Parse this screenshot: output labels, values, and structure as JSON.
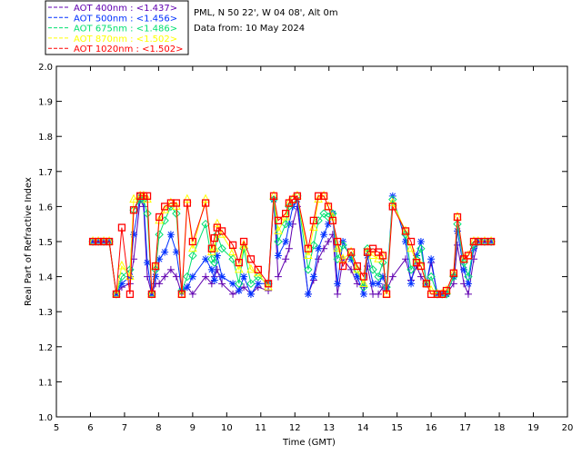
{
  "header": {
    "site": "PML, N 50 22', W 04 08', Alt 0m",
    "date": "Data from: 10 May 2024"
  },
  "chart_data": {
    "type": "line",
    "title": "",
    "xlabel": "Time (GMT)",
    "ylabel": "Real Part of Refractive Index",
    "xlim": [
      5,
      20
    ],
    "ylim": [
      1.0,
      2.0
    ],
    "xticks": [
      "5",
      "6",
      "7",
      "8",
      "9",
      "10",
      "11",
      "12",
      "13",
      "14",
      "15",
      "16",
      "17",
      "18",
      "19",
      "20"
    ],
    "yticks": [
      "1.0",
      "1.1",
      "1.2",
      "1.3",
      "1.4",
      "1.5",
      "1.6",
      "1.7",
      "1.8",
      "1.9",
      "2.0"
    ],
    "grid": false,
    "legend_position": "top-left",
    "x": [
      6.07,
      6.23,
      6.39,
      6.55,
      6.76,
      6.92,
      7.16,
      7.27,
      7.46,
      7.56,
      7.67,
      7.8,
      7.91,
      8.02,
      8.18,
      8.36,
      8.52,
      8.68,
      8.84,
      9.0,
      9.38,
      9.56,
      9.64,
      9.72,
      9.86,
      10.18,
      10.36,
      10.5,
      10.71,
      10.92,
      11.22,
      11.38,
      11.51,
      11.73,
      11.83,
      11.94,
      12.07,
      12.39,
      12.55,
      12.69,
      12.85,
      12.98,
      13.11,
      13.25,
      13.41,
      13.65,
      13.83,
      14.02,
      14.13,
      14.29,
      14.45,
      14.58,
      14.69,
      14.87,
      15.25,
      15.41,
      15.57,
      15.7,
      15.86,
      16.0,
      16.18,
      16.32,
      16.45,
      16.66,
      16.77,
      16.96,
      17.09,
      17.25,
      17.38,
      17.57,
      17.76
    ],
    "series": [
      {
        "name": "AOT  400nm : <1.437>",
        "color": "#6000b0",
        "marker": "plus",
        "values": [
          1.5,
          1.5,
          1.5,
          1.5,
          1.35,
          1.37,
          1.38,
          1.45,
          1.62,
          1.6,
          1.4,
          1.35,
          1.38,
          1.38,
          1.4,
          1.42,
          1.4,
          1.35,
          1.37,
          1.35,
          1.4,
          1.38,
          1.4,
          1.42,
          1.38,
          1.35,
          1.36,
          1.37,
          1.35,
          1.37,
          1.36,
          1.62,
          1.4,
          1.45,
          1.48,
          1.55,
          1.6,
          1.35,
          1.39,
          1.45,
          1.48,
          1.5,
          1.52,
          1.35,
          1.45,
          1.42,
          1.38,
          1.37,
          1.43,
          1.35,
          1.35,
          1.37,
          1.36,
          1.4,
          1.45,
          1.39,
          1.43,
          1.4,
          1.38,
          1.44,
          1.35,
          1.35,
          1.35,
          1.38,
          1.49,
          1.38,
          1.35,
          1.45,
          1.5,
          1.5,
          1.5
        ]
      },
      {
        "name": "AOT  500nm : <1.456>",
        "color": "#0030ff",
        "marker": "asterisk",
        "values": [
          1.5,
          1.5,
          1.5,
          1.5,
          1.35,
          1.38,
          1.4,
          1.52,
          1.63,
          1.62,
          1.44,
          1.35,
          1.4,
          1.45,
          1.47,
          1.52,
          1.47,
          1.36,
          1.37,
          1.4,
          1.45,
          1.42,
          1.39,
          1.46,
          1.4,
          1.38,
          1.36,
          1.4,
          1.35,
          1.38,
          1.38,
          1.62,
          1.46,
          1.5,
          1.55,
          1.6,
          1.62,
          1.35,
          1.4,
          1.48,
          1.52,
          1.55,
          1.58,
          1.38,
          1.5,
          1.45,
          1.4,
          1.35,
          1.46,
          1.38,
          1.38,
          1.4,
          1.37,
          1.63,
          1.5,
          1.38,
          1.46,
          1.5,
          1.38,
          1.45,
          1.35,
          1.35,
          1.35,
          1.4,
          1.53,
          1.42,
          1.38,
          1.48,
          1.5,
          1.5,
          1.5
        ]
      },
      {
        "name": "AOT  675nm : <1.486>",
        "color": "#00e070",
        "marker": "diamond",
        "values": [
          1.5,
          1.5,
          1.5,
          1.5,
          1.35,
          1.4,
          1.42,
          1.59,
          1.62,
          1.62,
          1.58,
          1.35,
          1.42,
          1.52,
          1.56,
          1.6,
          1.58,
          1.36,
          1.4,
          1.46,
          1.55,
          1.45,
          1.44,
          1.52,
          1.48,
          1.45,
          1.38,
          1.48,
          1.38,
          1.4,
          1.38,
          1.62,
          1.5,
          1.55,
          1.6,
          1.62,
          1.63,
          1.42,
          1.49,
          1.56,
          1.58,
          1.57,
          1.58,
          1.45,
          1.49,
          1.46,
          1.42,
          1.37,
          1.48,
          1.42,
          1.4,
          1.44,
          1.37,
          1.62,
          1.52,
          1.42,
          1.45,
          1.48,
          1.38,
          1.4,
          1.35,
          1.35,
          1.35,
          1.4,
          1.55,
          1.44,
          1.4,
          1.49,
          1.5,
          1.5,
          1.5
        ]
      },
      {
        "name": "AOT  870nm : <1.502>",
        "color": "#ffff00",
        "marker": "triangle",
        "values": [
          1.5,
          1.5,
          1.5,
          1.5,
          1.35,
          1.43,
          1.4,
          1.62,
          1.63,
          1.63,
          1.62,
          1.35,
          1.43,
          1.56,
          1.59,
          1.61,
          1.6,
          1.35,
          1.62,
          1.48,
          1.62,
          1.47,
          1.48,
          1.55,
          1.52,
          1.47,
          1.42,
          1.49,
          1.42,
          1.41,
          1.37,
          1.63,
          1.53,
          1.57,
          1.61,
          1.62,
          1.63,
          1.46,
          1.54,
          1.62,
          1.63,
          1.6,
          1.57,
          1.48,
          1.45,
          1.47,
          1.42,
          1.38,
          1.47,
          1.46,
          1.45,
          1.46,
          1.35,
          1.61,
          1.53,
          1.48,
          1.44,
          1.43,
          1.38,
          1.36,
          1.35,
          1.35,
          1.36,
          1.41,
          1.57,
          1.45,
          1.46,
          1.5,
          1.5,
          1.5,
          1.5
        ]
      },
      {
        "name": "AOT 1020nm : <1.502>",
        "color": "#ff0000",
        "marker": "square",
        "values": [
          1.5,
          1.5,
          1.5,
          1.5,
          1.35,
          1.54,
          1.35,
          1.59,
          1.63,
          1.63,
          1.63,
          1.35,
          1.43,
          1.57,
          1.6,
          1.61,
          1.61,
          1.35,
          1.61,
          1.5,
          1.61,
          1.48,
          1.51,
          1.54,
          1.53,
          1.49,
          1.44,
          1.5,
          1.45,
          1.42,
          1.38,
          1.63,
          1.56,
          1.58,
          1.61,
          1.62,
          1.63,
          1.48,
          1.56,
          1.63,
          1.63,
          1.6,
          1.56,
          1.5,
          1.43,
          1.47,
          1.43,
          1.4,
          1.47,
          1.48,
          1.47,
          1.46,
          1.35,
          1.6,
          1.53,
          1.5,
          1.44,
          1.43,
          1.38,
          1.35,
          1.35,
          1.35,
          1.36,
          1.41,
          1.57,
          1.45,
          1.46,
          1.5,
          1.5,
          1.5,
          1.5
        ]
      }
    ]
  }
}
